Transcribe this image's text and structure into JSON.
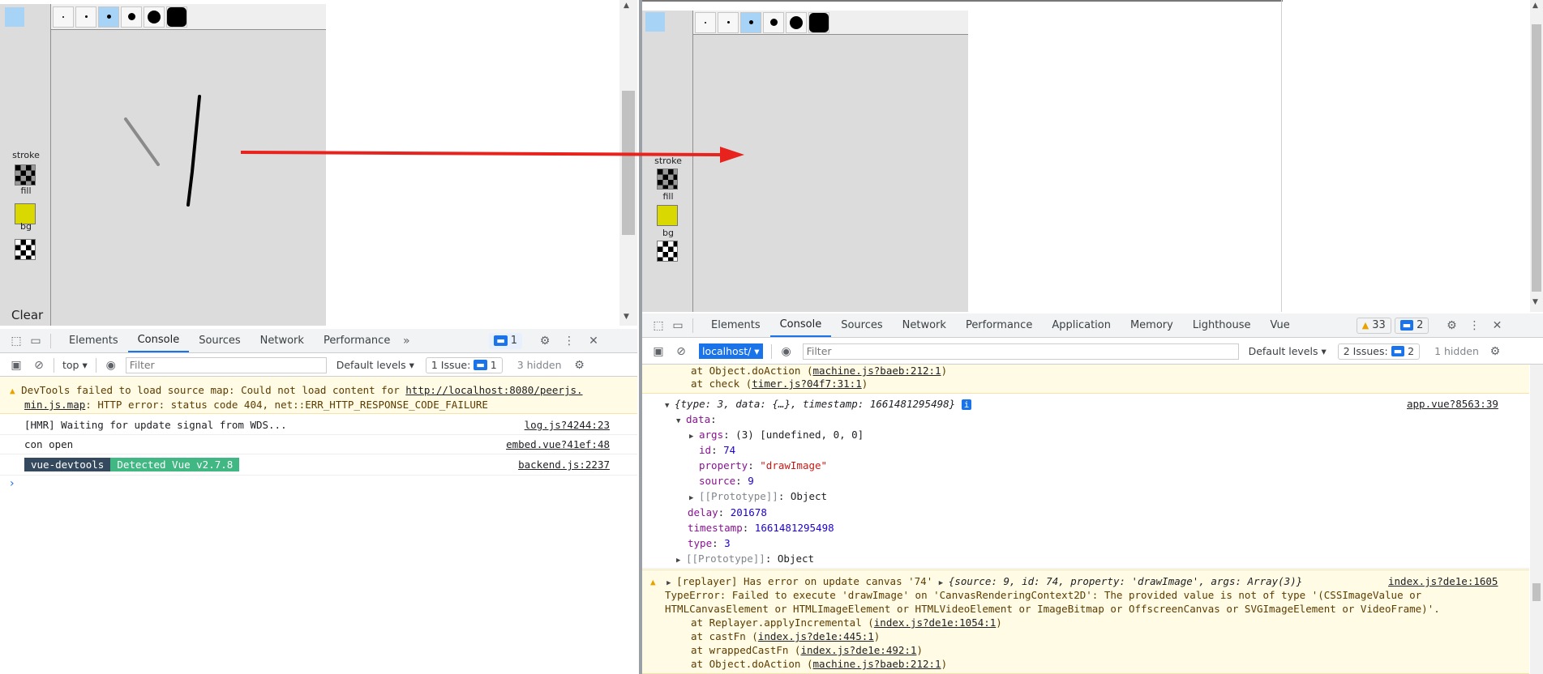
{
  "left": {
    "paint": {
      "labels": {
        "stroke": "stroke",
        "fill": "fill",
        "bg": "bg",
        "clear": "Clear"
      },
      "fill_color": "#d9d800",
      "accent": "#a7d3f7"
    },
    "devtools": {
      "tabs": [
        "Elements",
        "Console",
        "Sources",
        "Network",
        "Performance"
      ],
      "more_icon": "double-chevron-icon",
      "issues_count": "1",
      "context": "top",
      "filter_placeholder": "Filter",
      "levels": "Default levels",
      "issues_label": "1 Issue:",
      "issues_badge": "1",
      "hidden": "3 hidden",
      "messages": [
        {
          "text": "DevTools failed to load source map: Could not load content for ",
          "link": "http://localhost:8080/peerjs.",
          "link2": "min.js.map",
          "rest": ": HTTP error: status code 404, net::ERR_HTTP_RESPONSE_CODE_FAILURE"
        },
        {
          "text": "[HMR] Waiting for update signal from WDS...",
          "src": "log.js?4244:23"
        },
        {
          "text": "con open",
          "src": "embed.vue?41ef:48"
        },
        {
          "badge1": "vue-devtools",
          "badge2": "Detected Vue v2.7.8",
          "src": "backend.js:2237"
        }
      ],
      "prompt": "›"
    }
  },
  "right": {
    "paint": {
      "labels": {
        "stroke": "stroke",
        "fill": "fill",
        "bg": "bg"
      }
    },
    "devtools": {
      "tabs": [
        "Elements",
        "Console",
        "Sources",
        "Network",
        "Performance",
        "Application",
        "Memory",
        "Lighthouse",
        "Vue"
      ],
      "warnings": "33",
      "messages_count": "2",
      "context": "localhost/",
      "filter_placeholder": "Filter",
      "levels": "Default levels",
      "issues_label": "2 Issues:",
      "issues_badge": "2",
      "hidden": "1 hidden",
      "top_lines": [
        "at Object.doAction (",
        "machine.js?baeb:212:1",
        ")",
        "at check (",
        "timer.js?04f7:31:1",
        ")"
      ],
      "obj_summary": "{type: 3, data: {…}, timestamp: 1661481295498}",
      "obj_src": "app.vue?8563:39",
      "obj_lines": [
        {
          "k": "data",
          "v": ""
        },
        {
          "k": "args",
          "v": "(3) [undefined, 0, 0]"
        },
        {
          "k": "id",
          "v": "74"
        },
        {
          "k": "property",
          "v": "\"drawImage\""
        },
        {
          "k": "source",
          "v": "9"
        },
        {
          "k": "[[Prototype]]",
          "v": "Object"
        },
        {
          "k": "delay",
          "v": "201678"
        },
        {
          "k": "timestamp",
          "v": "1661481295498"
        },
        {
          "k": "type",
          "v": "3"
        },
        {
          "k": "[[Prototype]]",
          "v": "Object"
        }
      ],
      "error": {
        "head": "[replayer] Has error on update canvas '74' ",
        "obj": "{source: 9, id: 74, property: 'drawImage', args: Array(3)}",
        "src": "index.js?de1e:1605",
        "line1": "TypeError: Failed to execute 'drawImage' on 'CanvasRenderingContext2D': The provided value is not of type '(CSSImageValue or",
        "line2": "HTMLCanvasElement or HTMLImageElement or HTMLVideoElement or ImageBitmap or OffscreenCanvas or SVGImageElement or VideoFrame)'.",
        "stack": [
          {
            "pre": "at Replayer.applyIncremental (",
            "link": "index.js?de1e:1054:1",
            "post": ")"
          },
          {
            "pre": "at castFn (",
            "link": "index.js?de1e:445:1",
            "post": ")"
          },
          {
            "pre": "at wrappedCastFn (",
            "link": "index.js?de1e:492:1",
            "post": ")"
          },
          {
            "pre": "at Object.doAction (",
            "link": "machine.js?baeb:212:1",
            "post": ")"
          }
        ]
      }
    }
  }
}
